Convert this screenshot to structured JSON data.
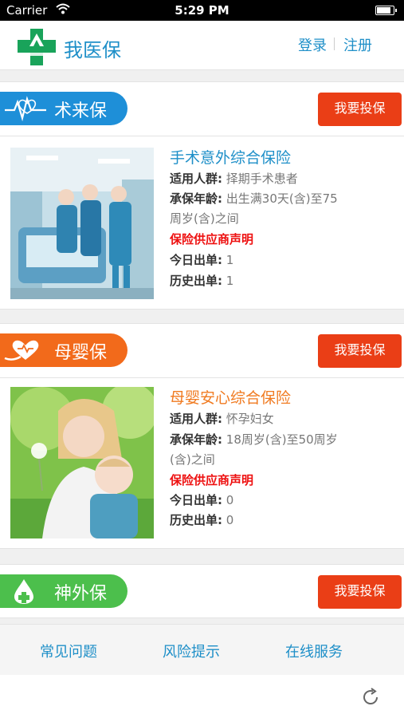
{
  "status_bar": {
    "carrier": "Carrier",
    "time": "5:29 PM"
  },
  "header": {
    "title": "我医保",
    "login": "登录",
    "register": "注册"
  },
  "sections": [
    {
      "badge": "术来保",
      "badge_color": "#1e8fd8",
      "buy_label": "我要投保",
      "product_name": "手术意外综合保险",
      "product_name_color": "#1e8fc8",
      "audience_label": "适用人群:",
      "audience": "择期手术患者",
      "age_label": "承保年龄:",
      "age_line1": "出生满30天(含)至75",
      "age_line2": "周岁(含)之间",
      "notice": "保险供应商声明",
      "today_label": "今日出单:",
      "today": "1",
      "history_label": "历史出单:",
      "history": "1"
    },
    {
      "badge": "母婴保",
      "badge_color": "#f26a1b",
      "buy_label": "我要投保",
      "product_name": "母婴安心综合保险",
      "product_name_color": "#f07a20",
      "audience_label": "适用人群:",
      "audience": "怀孕妇女",
      "age_label": "承保年龄:",
      "age_line1": "18周岁(含)至50周岁",
      "age_line2": "(含)之间",
      "notice": "保险供应商声明",
      "today_label": "今日出单:",
      "today": "0",
      "history_label": "历史出单:",
      "history": "0"
    },
    {
      "badge": "神外保",
      "badge_color": "#4cbf4c",
      "buy_label": "我要投保"
    }
  ],
  "footer": {
    "faq": "常见问题",
    "risk": "风险提示",
    "service": "在线服务"
  },
  "icons": {
    "logo": "green-cross-logo-icon",
    "badge1": "heartbeat-icon",
    "badge2": "heart-hand-icon",
    "badge3": "drop-cross-icon",
    "refresh": "refresh-icon"
  }
}
